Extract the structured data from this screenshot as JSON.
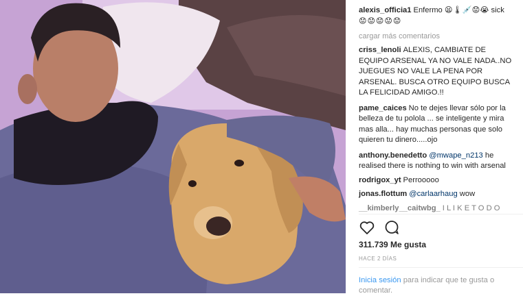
{
  "post": {
    "caption_user": "alexis_officia1",
    "caption_text": "Enfermo 😫🌡💉😟😭 sick",
    "caption_emoji_row": "😟😟😟😟😟",
    "load_more": "cargar más comentarios"
  },
  "comments": [
    {
      "user": "criss_lenoli",
      "text": "ALEXIS, CAMBIATE DE EQUIPO ARSENAL YA NO VALE NADA..NO JUEGUES NO VALE LA PENA POR ARSENAL. BUSCA OTRO EQUIPO BUSCA LA FELICIDAD AMIGO.!!"
    },
    {
      "user": "pame_caices",
      "text": "No te dejes llevar sólo por la belleza de tu polola ... se inteligente y mira mas alla... hay muchas personas que solo quieren tu dinero.....ojo"
    },
    {
      "user": "anthony.benedetto",
      "mention": "@mwape_n213",
      "text": "he realised there is nothing to win with arsenal"
    },
    {
      "user": "rodrigox_yt",
      "text": "Perrooooo"
    },
    {
      "user": "jonas.flottum",
      "mention": "@carlaarhaug",
      "text": "wow"
    },
    {
      "user": "__kimberly__caitwbg_",
      "text": "I L I K E T O D O"
    }
  ],
  "stats": {
    "likes": "311.739 Me gusta",
    "time": "HACE 2 DÍAS"
  },
  "login": {
    "link": "Inicia sesión",
    "text": "para indicar que te gusta o comentar."
  },
  "icons": {
    "like": "heart-icon",
    "comment": "comment-icon"
  }
}
